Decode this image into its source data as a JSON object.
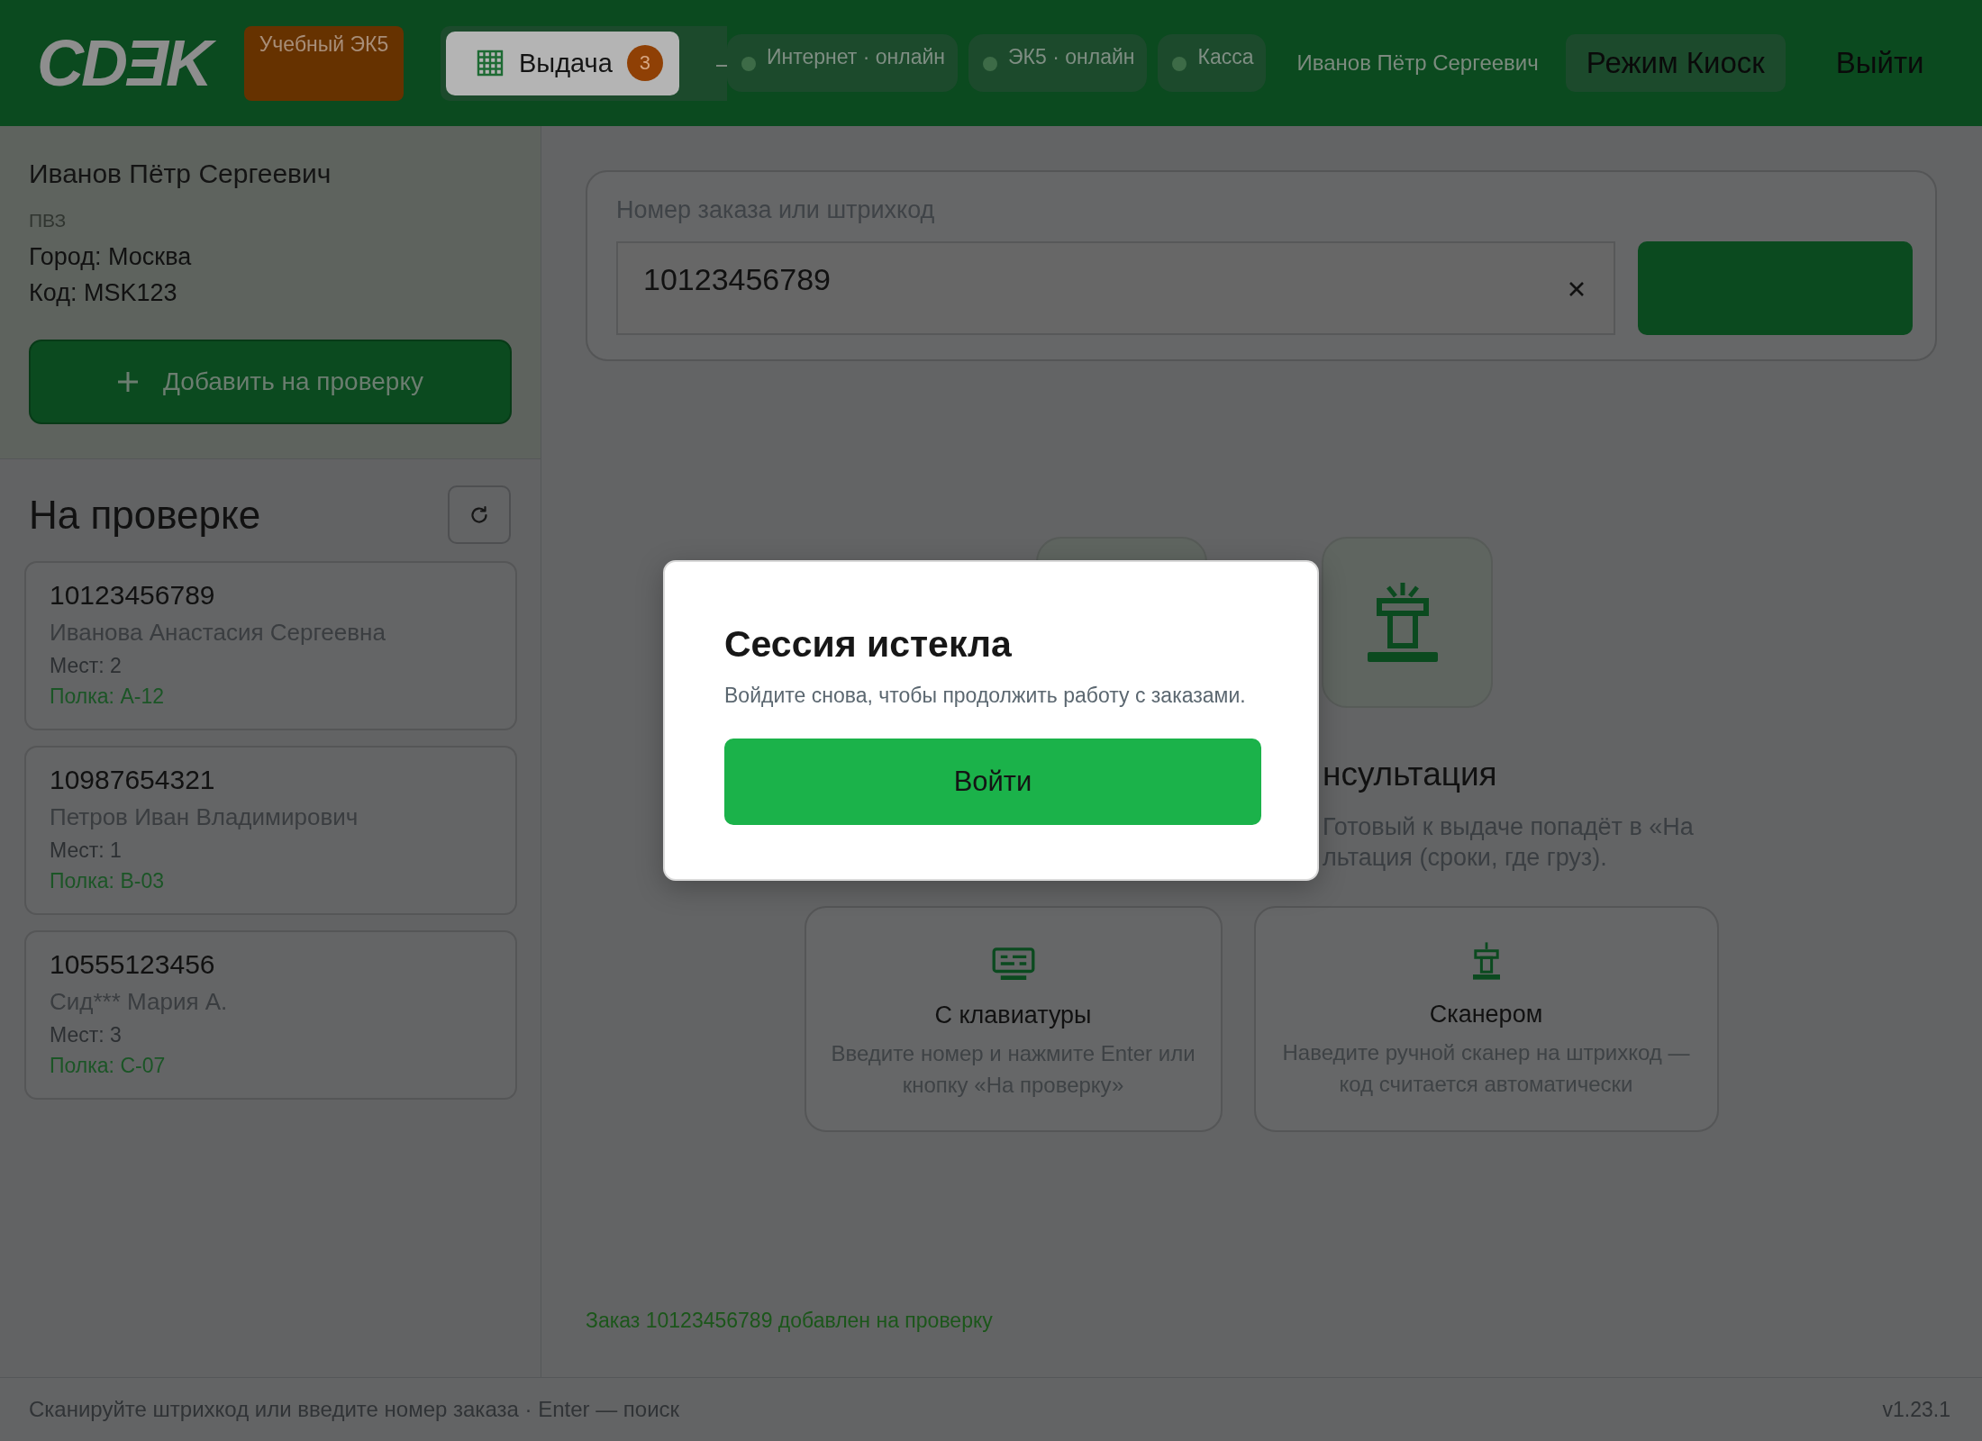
{
  "header": {
    "logo": "CDƎK",
    "training_badge": "Учебный ЭК5",
    "tabs": [
      {
        "label": "Выдача",
        "count": "3",
        "selected": true
      }
    ],
    "status_chips": [
      {
        "label": "Интернет · онлайн",
        "color": "#3d6b47"
      },
      {
        "label": "ЭК5 · онлайн",
        "color": "#3d6b47"
      },
      {
        "label": "Касса",
        "color": "#3d6b47"
      }
    ],
    "user_name": "Иванов Пётр Сергеевич",
    "kiosk_button": "Режим Киоск",
    "logout_button": "Выйти"
  },
  "sidebar": {
    "operator_name": "Иванов Пётр Сергеевич",
    "point_type": "ПВЗ",
    "city": "Город: Москва",
    "code": "Код: MSK123",
    "add_button": "Добавить на проверку",
    "queue_title": "На проверке",
    "queue": [
      {
        "number": "10123456789",
        "recipient": "Иванова Анастасия Сергеевна",
        "places": "Мест: 2",
        "shelf": "Полка: А-12"
      },
      {
        "number": "10987654321",
        "recipient": "Петров Иван Владимирович",
        "places": "Мест: 1",
        "shelf": "Полка: В-03"
      },
      {
        "number": "10555123456",
        "recipient": "Сид*** Мария А.",
        "places": "Мест: 3",
        "shelf": "Полка: С-07"
      }
    ]
  },
  "search": {
    "label": "Номер заказа или штрихкод",
    "value": "10123456789"
  },
  "hero": {
    "title": "нсультация",
    "description_lines": [
      "Готовый к выдаче попадёт в «На",
      "льтация (сроки, где груз)."
    ]
  },
  "methods": [
    {
      "kind": "keyboard",
      "title": "С клавиатуры",
      "description": "Введите номер и нажмите Enter или кнопку «На проверку»"
    },
    {
      "kind": "scanner",
      "title": "Сканером",
      "description": "Наведите ручной сканер на штрихкод — код считается автоматически"
    }
  ],
  "status_message": "Заказ 10123456789 добавлен на проверку",
  "footer": {
    "hint": "Сканируйте штрихкод или введите номер заказа · Enter — поиск",
    "version": "v1.23.1"
  },
  "modal": {
    "title": "Сессия истекла",
    "message": "Войдите снова, чтобы продолжить работу с заказами.",
    "button": "Войти"
  }
}
